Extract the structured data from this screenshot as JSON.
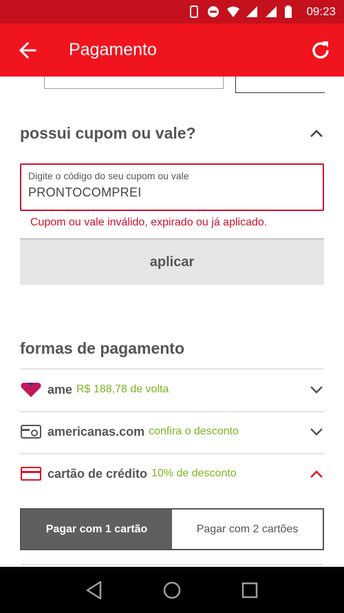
{
  "status_bar": {
    "time": "09:23",
    "icons": [
      "phone-icon",
      "do-not-disturb-icon",
      "wifi-icon",
      "signal-icon",
      "signal-icon",
      "battery-icon"
    ]
  },
  "app_bar": {
    "title": "Pagamento",
    "back_icon": "arrow-left-icon",
    "refresh_icon": "refresh-icon"
  },
  "coupon": {
    "heading": "possui cupom ou vale?",
    "field_label": "Digite o código do seu cupom ou vale",
    "field_value": "PRONTOCOMPREI",
    "error": "Cupom ou vale inválido, expirado ou já aplicado.",
    "apply_label": "aplicar"
  },
  "payment": {
    "heading": "formas de pagamento",
    "methods": [
      {
        "name": "ame",
        "note": "R$ 188,78 de volta",
        "icon": "ame-heart-icon",
        "expanded": false
      },
      {
        "name": "americanas.com",
        "note": "confira o desconto",
        "icon": "gift-card-icon",
        "expanded": false
      },
      {
        "name": "cartão de crédito",
        "note": "10% de desconto",
        "icon": "credit-card-icon",
        "expanded": true
      }
    ],
    "card_toggle": {
      "option_one": "Pagar com 1 cartão",
      "option_two": "Pagar com 2 cartões",
      "selected": "option_one"
    }
  },
  "colors": {
    "status_bar": "#c5101d",
    "app_bar": "#f0141e",
    "error_red": "#d0102a",
    "discount_green": "#7ab61f",
    "ame_pink": "#c2185b"
  },
  "nav_bar": {
    "icons": [
      "back-triangle-icon",
      "home-circle-icon",
      "recents-square-icon"
    ]
  }
}
